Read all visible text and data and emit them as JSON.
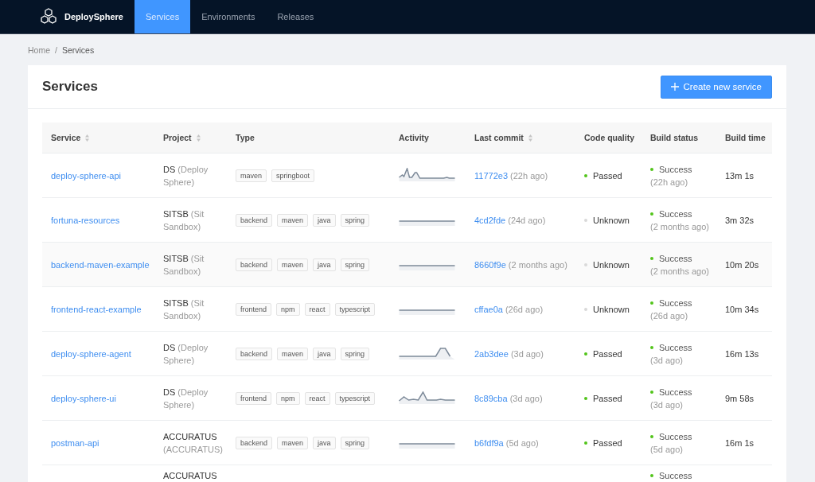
{
  "nav": {
    "brand": "DeploySphere",
    "tabs": [
      {
        "label": "Services",
        "selected": true
      },
      {
        "label": "Environments",
        "selected": false
      },
      {
        "label": "Releases",
        "selected": false
      }
    ]
  },
  "breadcrumb": {
    "items": [
      "Home",
      "Services"
    ],
    "separator": "/"
  },
  "page": {
    "title": "Services",
    "create_button": "Create new service"
  },
  "table": {
    "columns": [
      {
        "label": "Service",
        "sortable": true
      },
      {
        "label": "Project",
        "sortable": true
      },
      {
        "label": "Type",
        "sortable": false
      },
      {
        "label": "Activity",
        "sortable": false
      },
      {
        "label": "Last commit",
        "sortable": true
      },
      {
        "label": "Code quality",
        "sortable": false
      },
      {
        "label": "Build status",
        "sortable": false
      },
      {
        "label": "Build time",
        "sortable": false
      }
    ],
    "rows": [
      {
        "service": "deploy-sphere-api",
        "project_code": "DS",
        "project_name": "(Deploy Sphere)",
        "tags": [
          "maven",
          "springboot"
        ],
        "activity": {
          "kind": "burst"
        },
        "commit": "11772e3",
        "commit_age": "(22h ago)",
        "quality": {
          "label": "Passed",
          "color": "#52c41a"
        },
        "build": {
          "label": "Success",
          "age": "(22h ago)",
          "color": "#52c41a"
        },
        "build_time": "13m 1s"
      },
      {
        "service": "fortuna-resources",
        "project_code": "SITSB",
        "project_name": "(Sit Sandbox)",
        "tags": [
          "backend",
          "maven",
          "java",
          "spring"
        ],
        "activity": {
          "kind": "flat"
        },
        "commit": "4cd2fde",
        "commit_age": "(24d ago)",
        "quality": {
          "label": "Unknown",
          "color": "#d9d9d9"
        },
        "build": {
          "label": "Success",
          "age": "(2 months ago)",
          "color": "#52c41a"
        },
        "build_time": "3m 32s"
      },
      {
        "service": "backend-maven-example",
        "project_code": "SITSB",
        "project_name": "(Sit Sandbox)",
        "tags": [
          "backend",
          "maven",
          "java",
          "spring"
        ],
        "activity": {
          "kind": "flat"
        },
        "commit": "8660f9e",
        "commit_age": "(2 months ago)",
        "quality": {
          "label": "Unknown",
          "color": "#d9d9d9"
        },
        "build": {
          "label": "Success",
          "age": "(2 months ago)",
          "color": "#52c41a"
        },
        "build_time": "10m 20s"
      },
      {
        "service": "frontend-react-example",
        "project_code": "SITSB",
        "project_name": "(Sit Sandbox)",
        "tags": [
          "frontend",
          "npm",
          "react",
          "typescript"
        ],
        "activity": {
          "kind": "flat"
        },
        "commit": "cffae0a",
        "commit_age": "(26d ago)",
        "quality": {
          "label": "Unknown",
          "color": "#d9d9d9"
        },
        "build": {
          "label": "Success",
          "age": "(26d ago)",
          "color": "#52c41a"
        },
        "build_time": "10m 34s"
      },
      {
        "service": "deploy-sphere-agent",
        "project_code": "DS",
        "project_name": "(Deploy Sphere)",
        "tags": [
          "backend",
          "maven",
          "java",
          "spring"
        ],
        "activity": {
          "kind": "plateau"
        },
        "commit": "2ab3dee",
        "commit_age": "(3d ago)",
        "quality": {
          "label": "Passed",
          "color": "#52c41a"
        },
        "build": {
          "label": "Success",
          "age": "(3d ago)",
          "color": "#52c41a"
        },
        "build_time": "16m 13s"
      },
      {
        "service": "deploy-sphere-ui",
        "project_code": "DS",
        "project_name": "(Deploy Sphere)",
        "tags": [
          "frontend",
          "npm",
          "react",
          "typescript"
        ],
        "activity": {
          "kind": "wave"
        },
        "commit": "8c89cba",
        "commit_age": "(3d ago)",
        "quality": {
          "label": "Passed",
          "color": "#52c41a"
        },
        "build": {
          "label": "Success",
          "age": "(3d ago)",
          "color": "#52c41a"
        },
        "build_time": "9m 58s"
      },
      {
        "service": "postman-api",
        "project_code": "ACCURATUS",
        "project_name": "(ACCURATUS)",
        "tags": [
          "backend",
          "maven",
          "java",
          "spring"
        ],
        "activity": {
          "kind": "flat"
        },
        "commit": "b6fdf9a",
        "commit_age": "(5d ago)",
        "quality": {
          "label": "Passed",
          "color": "#52c41a"
        },
        "build": {
          "label": "Success",
          "age": "(5d ago)",
          "color": "#52c41a"
        },
        "build_time": "16m 1s"
      },
      {
        "project_code": "ACCURATUS",
        "build": {
          "label": "Success",
          "color": "#52c41a"
        }
      }
    ]
  }
}
